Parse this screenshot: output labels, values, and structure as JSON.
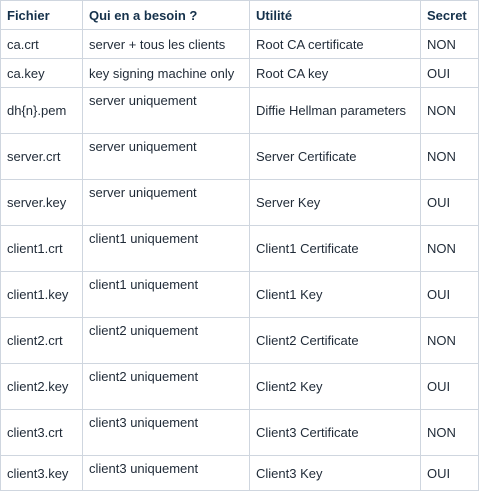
{
  "table": {
    "headers": [
      "Fichier",
      "Qui en a besoin ?",
      "Utilité",
      "Secret"
    ],
    "rows": [
      {
        "fichier": "ca.crt",
        "besoin": "server + tous les clients",
        "utilite": "Root CA certificate",
        "secret": "NON"
      },
      {
        "fichier": "ca.key",
        "besoin": "key signing machine only",
        "utilite": "Root CA key",
        "secret": "OUI"
      },
      {
        "fichier": "dh{n}.pem",
        "besoin": "server uniquement",
        "utilite": "Diffie Hellman parameters",
        "secret": "NON"
      },
      {
        "fichier": "server.crt",
        "besoin": "server uniquement",
        "utilite": "Server Certificate",
        "secret": "NON"
      },
      {
        "fichier": "server.key",
        "besoin": "server uniquement",
        "utilite": "Server Key",
        "secret": "OUI"
      },
      {
        "fichier": "client1.crt",
        "besoin": "client1 uniquement",
        "utilite": "Client1 Certificate",
        "secret": "NON"
      },
      {
        "fichier": "client1.key",
        "besoin": "client1 uniquement",
        "utilite": "Client1 Key",
        "secret": "OUI"
      },
      {
        "fichier": "client2.crt",
        "besoin": "client2 uniquement",
        "utilite": "Client2 Certificate",
        "secret": "NON"
      },
      {
        "fichier": "client2.key",
        "besoin": "client2 uniquement",
        "utilite": "Client2 Key",
        "secret": "OUI"
      },
      {
        "fichier": "client3.crt",
        "besoin": "client3 uniquement",
        "utilite": "Client3 Certificate",
        "secret": "NON"
      },
      {
        "fichier": "client3.key",
        "besoin": "client3 uniquement",
        "utilite": "Client3 Key",
        "secret": "OUI"
      }
    ]
  }
}
